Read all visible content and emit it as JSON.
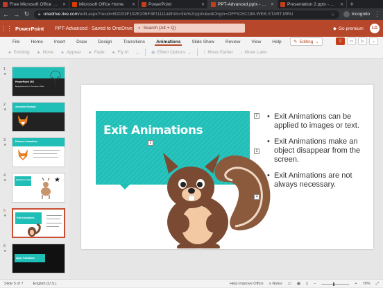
{
  "browser": {
    "tabs": [
      {
        "title": "Free Microsoft Office Onlin",
        "color": "#c0392b",
        "active": false
      },
      {
        "title": "Microsoft Office Home",
        "color": "#d83b01",
        "active": false
      },
      {
        "title": "PowerPoint",
        "color": "#c43e1c",
        "active": false
      },
      {
        "title": "PPT-Advanced.pptx - Micr",
        "color": "#c43e1c",
        "active": true
      },
      {
        "title": "Presentation 2.pptx - Micr",
        "color": "#c43e1c",
        "active": false
      }
    ],
    "new_tab": "+",
    "url_host": "onedrive.live.com",
    "url_rest": "/edit.aspx?resid=6DD03F192E206F4E!1111&ithint=file%2cpptx&wdOrigin=OFFICECOM-WEB.START.MRU",
    "profile_label": "Incognito"
  },
  "app": {
    "name": "PowerPoint",
    "document": "PPT-Advanced  -  Saved to OneDrive",
    "search_placeholder": "Search (Alt + Q)",
    "premium": "Go premium",
    "user_initials": "LD",
    "brand_color": "#b7472a"
  },
  "ribbon": {
    "tabs": [
      "File",
      "Home",
      "Insert",
      "Draw",
      "Design",
      "Transitions",
      "Animations",
      "Slide Show",
      "Review",
      "View",
      "Help"
    ],
    "active_tab": "Animations",
    "mode": "Editing",
    "commands": {
      "existing": "Existing",
      "none": "None",
      "appear": "Appear",
      "fade": "Fade",
      "fly_in": "Fly In",
      "effect_options": "Effect Options",
      "move_earlier": "Move Earlier",
      "move_later": "Move Later"
    }
  },
  "thumbnails": [
    {
      "number": "1",
      "title": "PowerPoint 365",
      "subtitle": "Applying Animations & Transitions to Slides"
    },
    {
      "number": "2",
      "title": "Animation Example"
    },
    {
      "number": "3",
      "title": "Entrance Animations"
    },
    {
      "number": "4",
      "title": "Emphasis Animations"
    },
    {
      "number": "5",
      "title": "Exit Animations",
      "selected": true
    },
    {
      "number": "6",
      "title": "Apply Transitions"
    }
  ],
  "slide": {
    "title": "Exit Animations",
    "title_tag": "1",
    "bullets": [
      {
        "tag": "2",
        "text": "Exit Animations can be applied to images or text."
      },
      {
        "tag": "3",
        "text": "Exit Animations make an object disappear from the screen."
      },
      {
        "tag": "4",
        "text": "Exit Animations are not always necessary."
      }
    ],
    "accent_color": "#1fbfb8"
  },
  "status": {
    "slide_counter": "Slide 5 of 7",
    "language": "English (U.S.)",
    "help": "Help Improve Office",
    "notes": "Notes",
    "zoom": "78%"
  }
}
